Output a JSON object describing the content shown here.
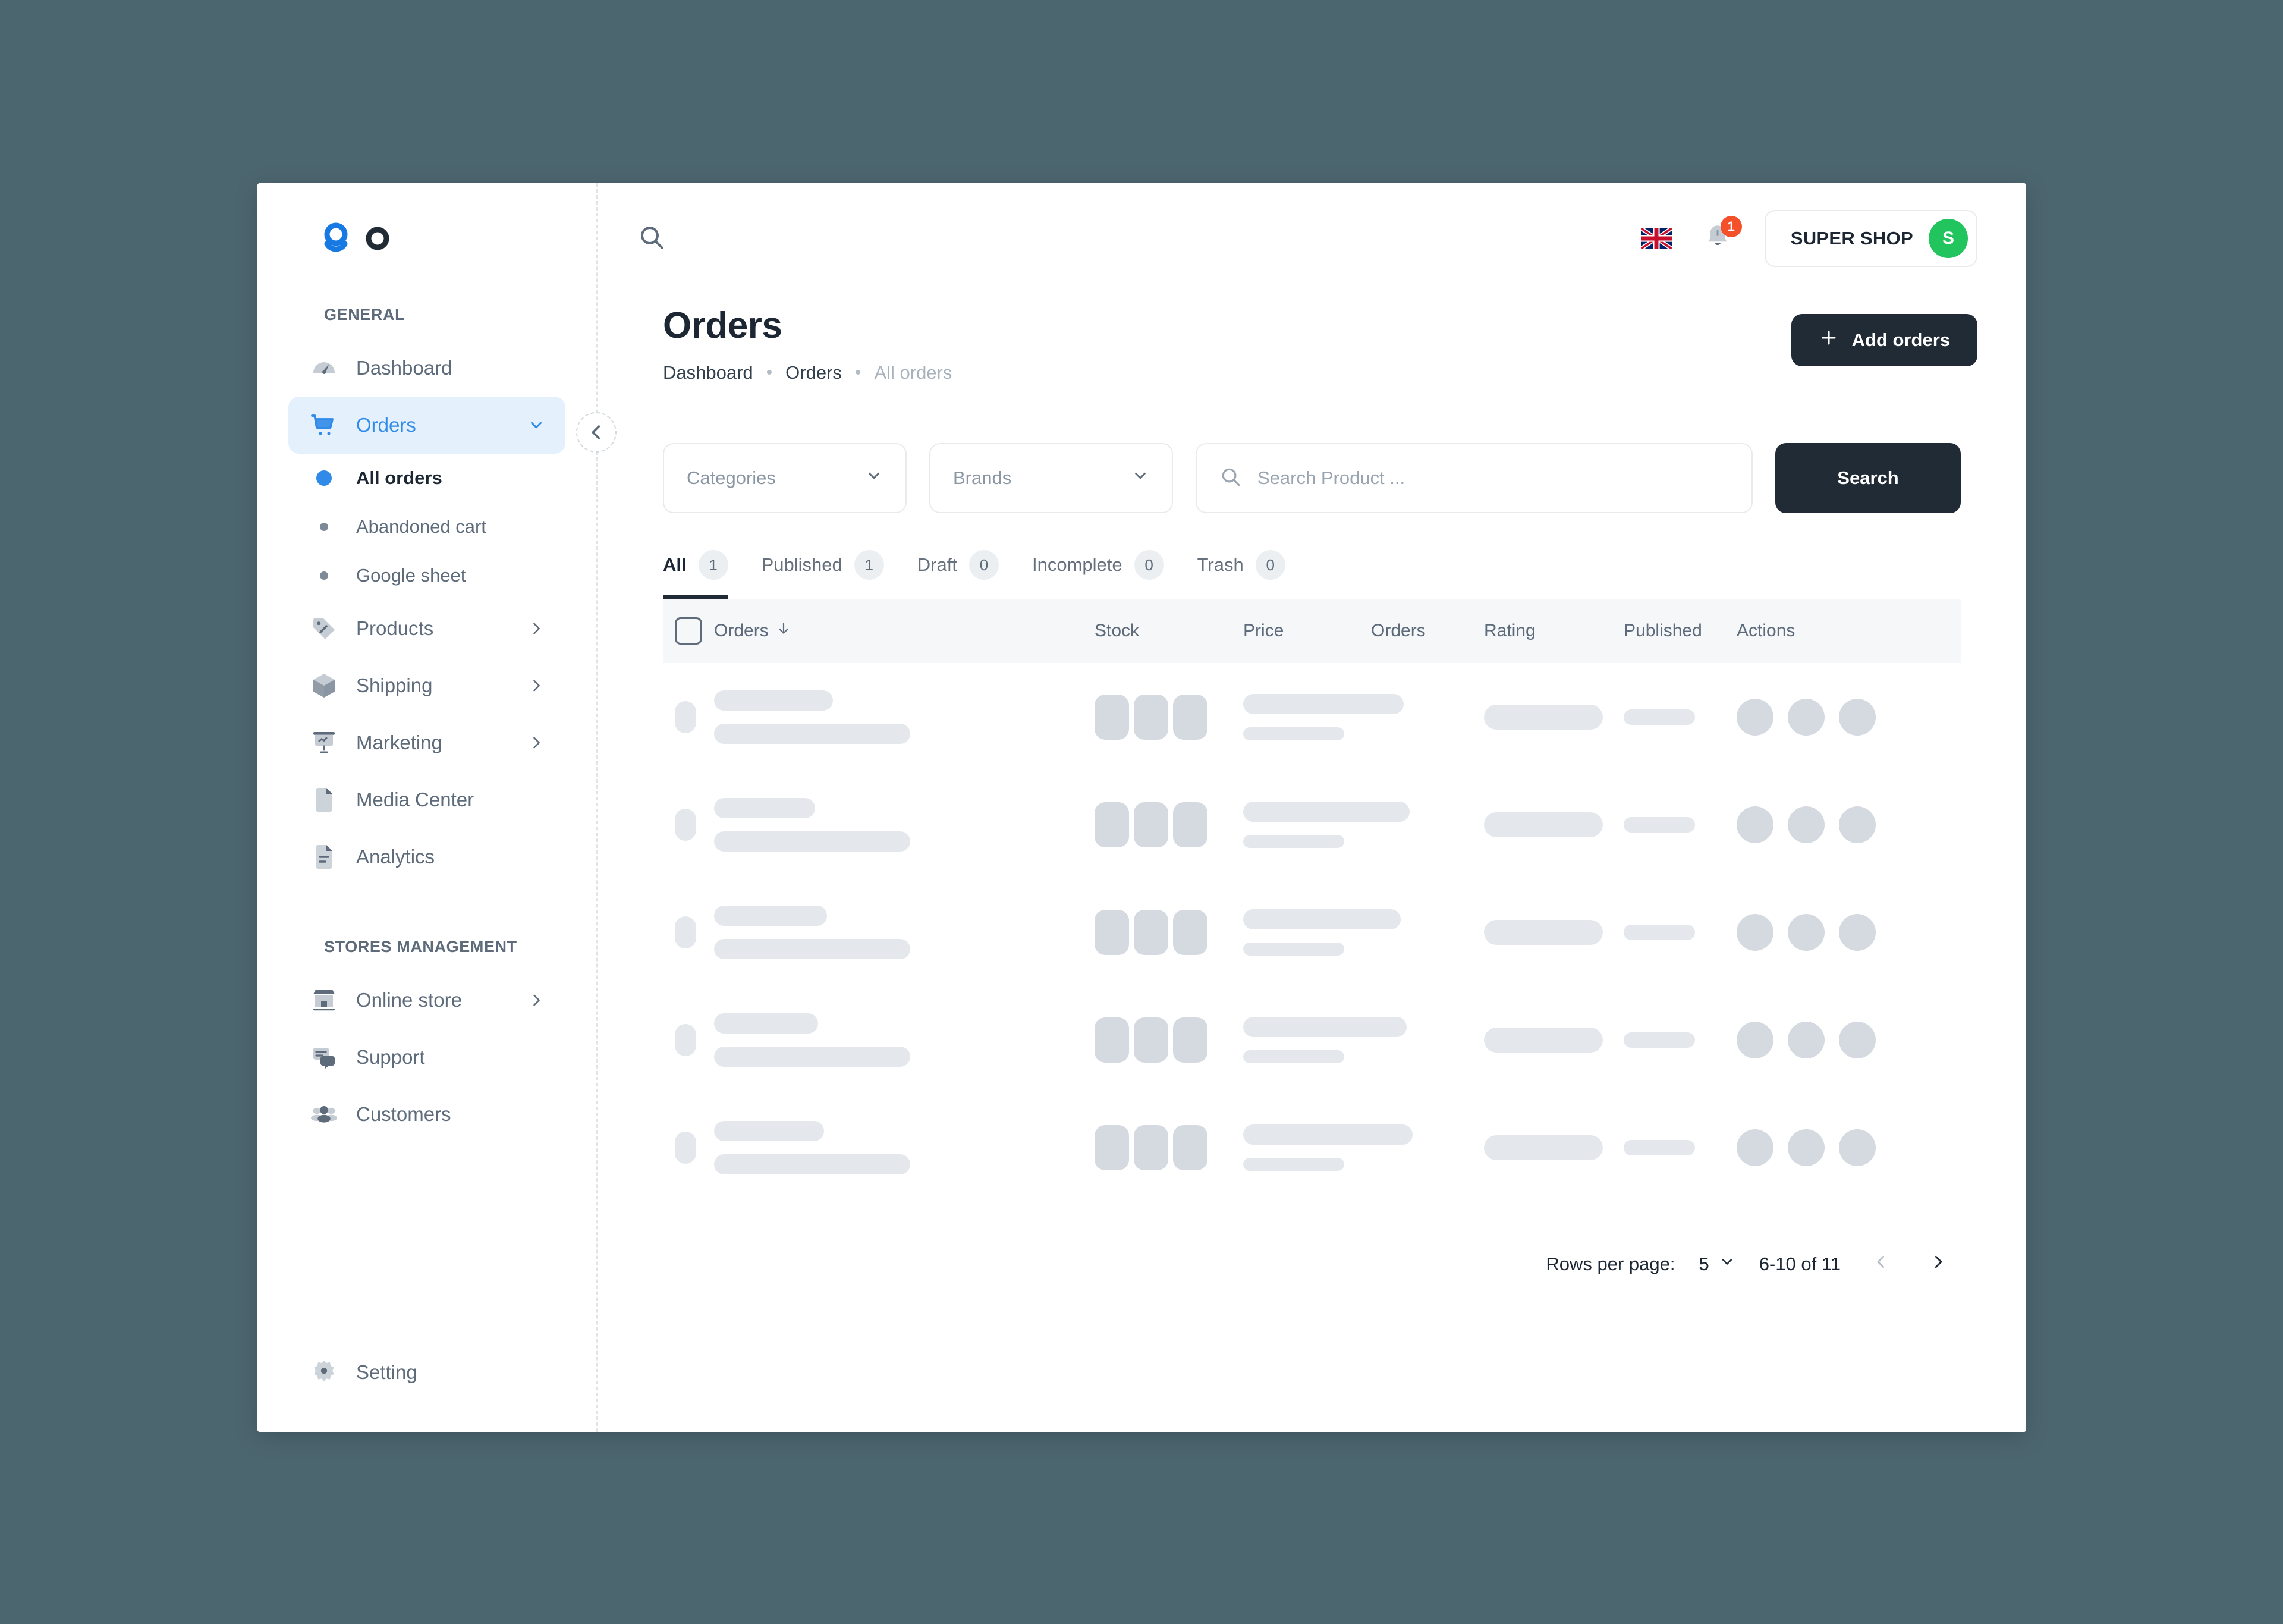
{
  "window": {
    "background_color": "#4c6670",
    "surface_color": "#ffffff"
  },
  "brand": {
    "logo_name": "go-logo",
    "primary_color": "#2f8ae8",
    "dark_color": "#212b36"
  },
  "sidebar": {
    "collapse_button": "collapse-sidebar-icon",
    "sections": [
      {
        "title": "GENERAL",
        "items": [
          {
            "label": "Dashboard",
            "icon": "gauge-icon",
            "expandable": false
          },
          {
            "label": "Orders",
            "icon": "shopping-cart-icon",
            "expandable": true,
            "expanded": true,
            "active": true,
            "children": [
              {
                "label": "All orders",
                "active": true
              },
              {
                "label": "Abandoned cart",
                "active": false
              },
              {
                "label": "Google sheet",
                "active": false
              }
            ]
          },
          {
            "label": "Products",
            "icon": "tag-icon",
            "expandable": true
          },
          {
            "label": "Shipping",
            "icon": "box-icon",
            "expandable": true
          },
          {
            "label": "Marketing",
            "icon": "presentation-icon",
            "expandable": true
          },
          {
            "label": "Media Center",
            "icon": "file-icon",
            "expandable": false
          },
          {
            "label": "Analytics",
            "icon": "document-chart-icon",
            "expandable": false
          }
        ]
      },
      {
        "title": "STORES MANAGEMENT",
        "items": [
          {
            "label": "Online store",
            "icon": "storefront-icon",
            "expandable": true
          },
          {
            "label": "Support",
            "icon": "chat-icon",
            "expandable": false
          },
          {
            "label": "Customers",
            "icon": "users-icon",
            "expandable": false
          }
        ]
      }
    ],
    "footer": {
      "label": "Setting",
      "icon": "gear-icon"
    }
  },
  "topbar": {
    "search_icon": "search-icon",
    "language_flag": "uk-flag-icon",
    "notifications": {
      "icon": "bell-icon",
      "count": "1",
      "badge_color": "#f4502a"
    },
    "shop": {
      "name": "SUPER SHOP",
      "avatar_initial": "S",
      "avatar_color": "#21c45d"
    }
  },
  "page": {
    "title": "Orders",
    "breadcrumb": [
      {
        "label": "Dashboard",
        "muted": false
      },
      {
        "label": "Orders",
        "muted": false
      },
      {
        "label": "All orders",
        "muted": true
      }
    ],
    "add_button": {
      "label": "Add orders",
      "icon": "plus-icon"
    }
  },
  "filters": {
    "categories": {
      "label": "Categories",
      "icon": "chevron-down-icon"
    },
    "brands": {
      "label": "Brands",
      "icon": "chevron-down-icon"
    },
    "search": {
      "placeholder": "Search Product ...",
      "value": "",
      "icon": "search-icon"
    },
    "search_button": "Search"
  },
  "tabs": [
    {
      "label": "All",
      "count": "1",
      "active": true
    },
    {
      "label": "Published",
      "count": "1",
      "active": false
    },
    {
      "label": "Draft",
      "count": "0",
      "active": false
    },
    {
      "label": "Incomplete",
      "count": "0",
      "active": false
    },
    {
      "label": "Trash",
      "count": "0",
      "active": false
    }
  ],
  "table": {
    "select_all": "select-all-checkbox",
    "columns": [
      {
        "label": "Orders",
        "sortable": true,
        "sort_icon": "arrow-down-icon"
      },
      {
        "label": "Stock"
      },
      {
        "label": "Price"
      },
      {
        "label": "Orders"
      },
      {
        "label": "Rating"
      },
      {
        "label": "Published"
      },
      {
        "label": "Actions"
      }
    ],
    "loading": true,
    "skeleton_row_count": 5
  },
  "pagination": {
    "rows_per_page_label": "Rows per page:",
    "rows_per_page_value": "5",
    "range_label": "6-10 of 11",
    "prev_icon": "chevron-left-icon",
    "next_icon": "chevron-right-icon",
    "prev_disabled": true
  }
}
